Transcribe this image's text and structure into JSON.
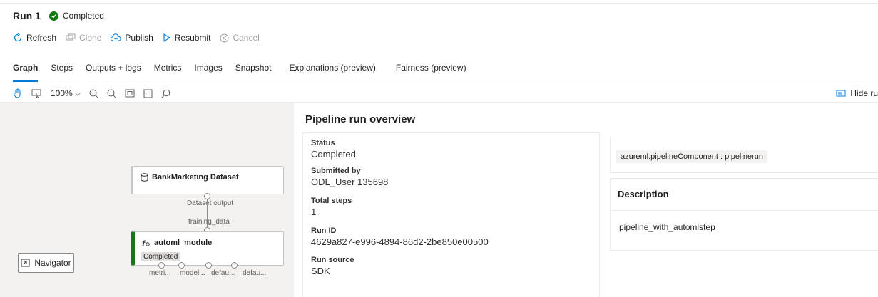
{
  "header": {
    "title": "Run 1",
    "status": "Completed"
  },
  "toolbar": {
    "refresh": "Refresh",
    "clone": "Clone",
    "publish": "Publish",
    "resubmit": "Resubmit",
    "cancel": "Cancel"
  },
  "tabs": [
    "Graph",
    "Steps",
    "Outputs + logs",
    "Metrics",
    "Images",
    "Snapshot",
    "Explanations (preview)",
    "Fairness (preview)"
  ],
  "graph_toolbar": {
    "zoom": "100%",
    "hide_run": "Hide ru"
  },
  "graph": {
    "dataset_node": {
      "title": "BankMarketing Dataset",
      "output_label": "Dataset output"
    },
    "automl_node": {
      "input_label": "training_data",
      "title": "automl_module",
      "status": "Completed",
      "ports": [
        "metri...",
        "model...",
        "defau...",
        "defau..."
      ]
    },
    "navigator": "Navigator"
  },
  "overview": {
    "title": "Pipeline run overview",
    "status_label": "Status",
    "status_value": "Completed",
    "submitted_label": "Submitted by",
    "submitted_value": "ODL_User 135698",
    "steps_label": "Total steps",
    "steps_value": "1",
    "runid_label": "Run ID",
    "runid_value": "4629a827-e996-4894-86d2-2be850e00500",
    "source_label": "Run source",
    "source_value": "SDK"
  },
  "tags": {
    "tag": "azureml.pipelineComponent : pipelinerun"
  },
  "description": {
    "title": "Description",
    "text": "pipeline_with_automlstep"
  },
  "colors": {
    "accent": "#0078d4",
    "success": "#107c10"
  }
}
